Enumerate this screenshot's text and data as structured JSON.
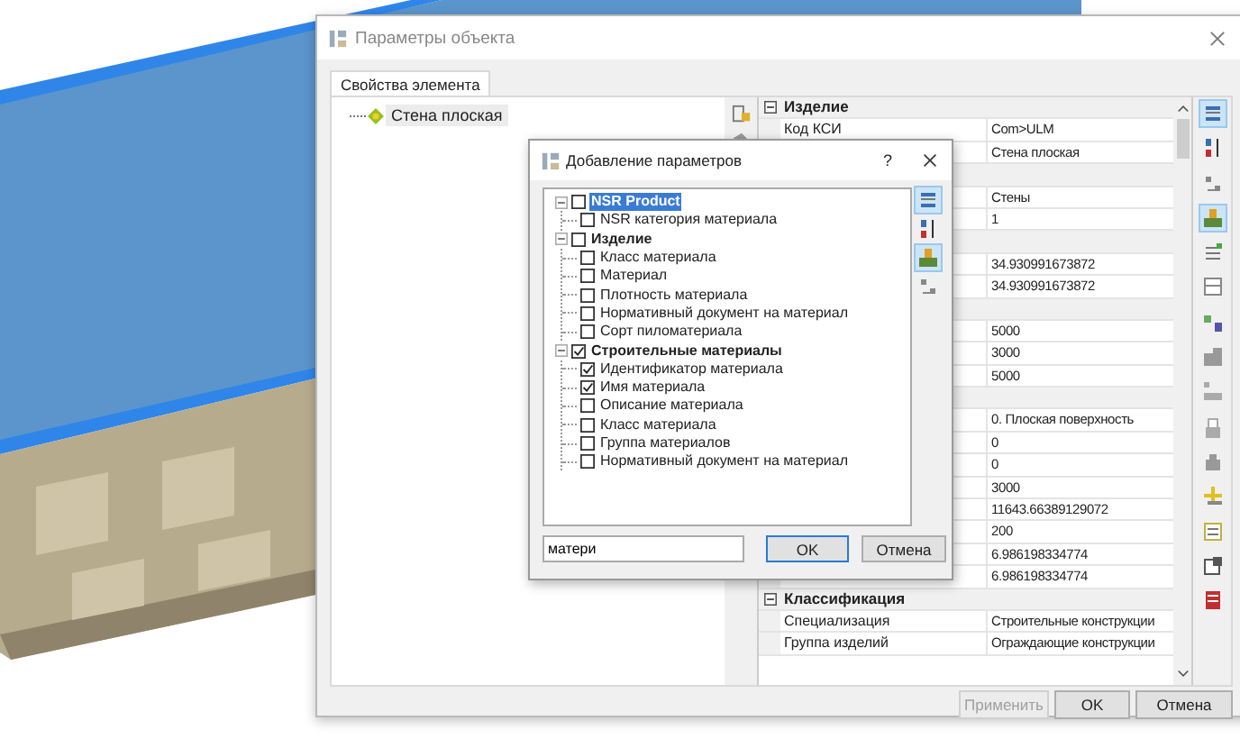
{
  "window": {
    "title": "Параметры объекта",
    "tabs": [
      {
        "label": "Свойства элемента",
        "selected": true
      }
    ],
    "tree": [
      {
        "label": "Стена плоская",
        "selected": true
      }
    ],
    "property_grid": {
      "rows": [
        {
          "kind": "group",
          "title": "Изделие",
          "expanded": true
        },
        {
          "kind": "prop",
          "name": "Код КСИ",
          "value": "Com>ULM"
        },
        {
          "kind": "prop",
          "value": "Стена плоская"
        },
        {
          "kind": "group"
        },
        {
          "kind": "prop",
          "value": "Стены"
        },
        {
          "kind": "prop",
          "value": "1"
        },
        {
          "kind": "group"
        },
        {
          "kind": "prop",
          "value": "34.930991673872"
        },
        {
          "kind": "prop",
          "value": "34.930991673872"
        },
        {
          "kind": "group"
        },
        {
          "kind": "prop",
          "value": "5000"
        },
        {
          "kind": "prop",
          "value": "3000"
        },
        {
          "kind": "prop",
          "value": "5000"
        },
        {
          "kind": "group"
        },
        {
          "kind": "prop",
          "value": "0. Плоская поверхность"
        },
        {
          "kind": "prop",
          "value": "0"
        },
        {
          "kind": "prop",
          "value": "0"
        },
        {
          "kind": "prop",
          "value": "3000"
        },
        {
          "kind": "prop",
          "value": "11643.66389129072"
        },
        {
          "kind": "prop",
          "value": "200"
        },
        {
          "kind": "prop",
          "value": "6.986198334774"
        },
        {
          "kind": "prop",
          "value": "6.986198334774"
        },
        {
          "kind": "group",
          "title": "Классификация",
          "expanded": true
        },
        {
          "kind": "prop",
          "name": "Специализация",
          "value": "Строительные конструкции"
        },
        {
          "kind": "prop",
          "name": "Группа изделий",
          "value": "Ограждающие конструкции"
        }
      ]
    },
    "buttons": [
      {
        "label": "Применить",
        "disabled": true
      },
      {
        "label": "OK",
        "disabled": false
      },
      {
        "label": "Отмена",
        "disabled": false
      }
    ]
  },
  "dialog": {
    "title": "Добавление параметров",
    "help": "?",
    "tree": [
      {
        "label": "NSR Product",
        "checked": false,
        "selected": true,
        "expanded": true,
        "children": [
          {
            "label": "NSR категория материала",
            "checked": false,
            "selected": false
          }
        ]
      },
      {
        "label": "Изделие",
        "checked": false,
        "selected": false,
        "expanded": true,
        "children": [
          {
            "label": "Класс материала",
            "checked": false,
            "selected": false
          },
          {
            "label": "Материал",
            "checked": false,
            "selected": false
          },
          {
            "label": "Плотность материала",
            "checked": false,
            "selected": false
          },
          {
            "label": "Нормативный документ на материал",
            "checked": false,
            "selected": false
          },
          {
            "label": "Сорт пиломатериала",
            "checked": false,
            "selected": false
          }
        ]
      },
      {
        "label": "Строительные материалы",
        "checked": true,
        "selected": false,
        "expanded": true,
        "children": [
          {
            "label": "Идентификатор материала",
            "checked": true,
            "selected": false
          },
          {
            "label": "Имя материала",
            "checked": true,
            "selected": false
          },
          {
            "label": "Описание материала",
            "checked": false,
            "selected": false
          },
          {
            "label": "Класс материала",
            "checked": false,
            "selected": false
          },
          {
            "label": "Группа материалов",
            "checked": false,
            "selected": false
          },
          {
            "label": "Нормативный документ на материал",
            "checked": false,
            "selected": false
          }
        ]
      }
    ],
    "search": {
      "value": "матери"
    },
    "buttons": [
      {
        "label": "OK",
        "default": true
      },
      {
        "label": "Отмена",
        "default": false
      }
    ]
  }
}
